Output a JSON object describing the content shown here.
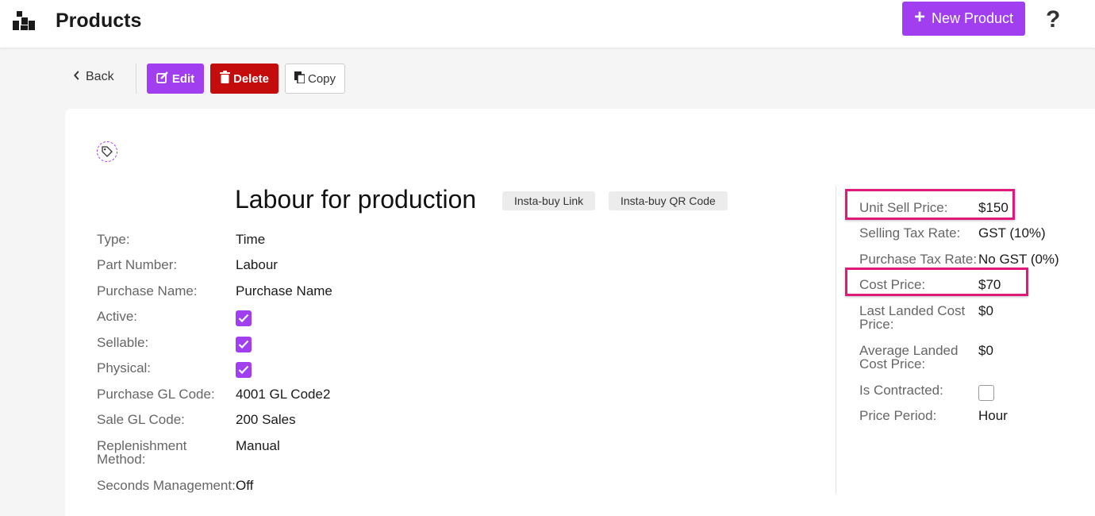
{
  "header": {
    "title": "Products",
    "new_button_label": "New Product",
    "help_label": "?"
  },
  "toolbar": {
    "back_label": "Back",
    "edit_label": "Edit",
    "delete_label": "Delete",
    "copy_label": "Copy"
  },
  "product": {
    "name": "Labour for production",
    "insta_buy_link": "Insta-buy Link",
    "insta_buy_qr": "Insta-buy QR Code",
    "details": {
      "type_label": "Type:",
      "type_value": "Time",
      "part_number_label": "Part Number:",
      "part_number_value": "Labour",
      "purchase_name_label": "Purchase Name:",
      "purchase_name_value": "Purchase Name",
      "active_label": "Active:",
      "active_checked": true,
      "sellable_label": "Sellable:",
      "sellable_checked": true,
      "physical_label": "Physical:",
      "physical_checked": true,
      "purchase_gl_label": "Purchase GL Code:",
      "purchase_gl_value": "4001 GL Code2",
      "sale_gl_label": "Sale GL Code:",
      "sale_gl_value": "200 Sales",
      "replenishment_label": "Replenishment Method:",
      "replenishment_value": "Manual",
      "seconds_label": "Seconds Management:",
      "seconds_value": "Off"
    },
    "pricing": {
      "unit_sell_label": "Unit Sell Price:",
      "unit_sell_value": "$150",
      "selling_tax_label": "Selling Tax Rate:",
      "selling_tax_value": "GST (10%)",
      "purchase_tax_label": "Purchase Tax Rate:",
      "purchase_tax_value": "No GST (0%)",
      "cost_label": "Cost Price:",
      "cost_value": "$70",
      "last_landed_label": "Last Landed Cost Price:",
      "last_landed_value": "$0",
      "avg_landed_label": "Average Landed Cost Price:",
      "avg_landed_value": "$0",
      "contracted_label": "Is Contracted:",
      "contracted_checked": false,
      "price_period_label": "Price Period:",
      "price_period_value": "Hour"
    }
  },
  "colors": {
    "accent": "#a03ef0",
    "danger": "#c40c0c",
    "highlight": "#e0197a"
  }
}
